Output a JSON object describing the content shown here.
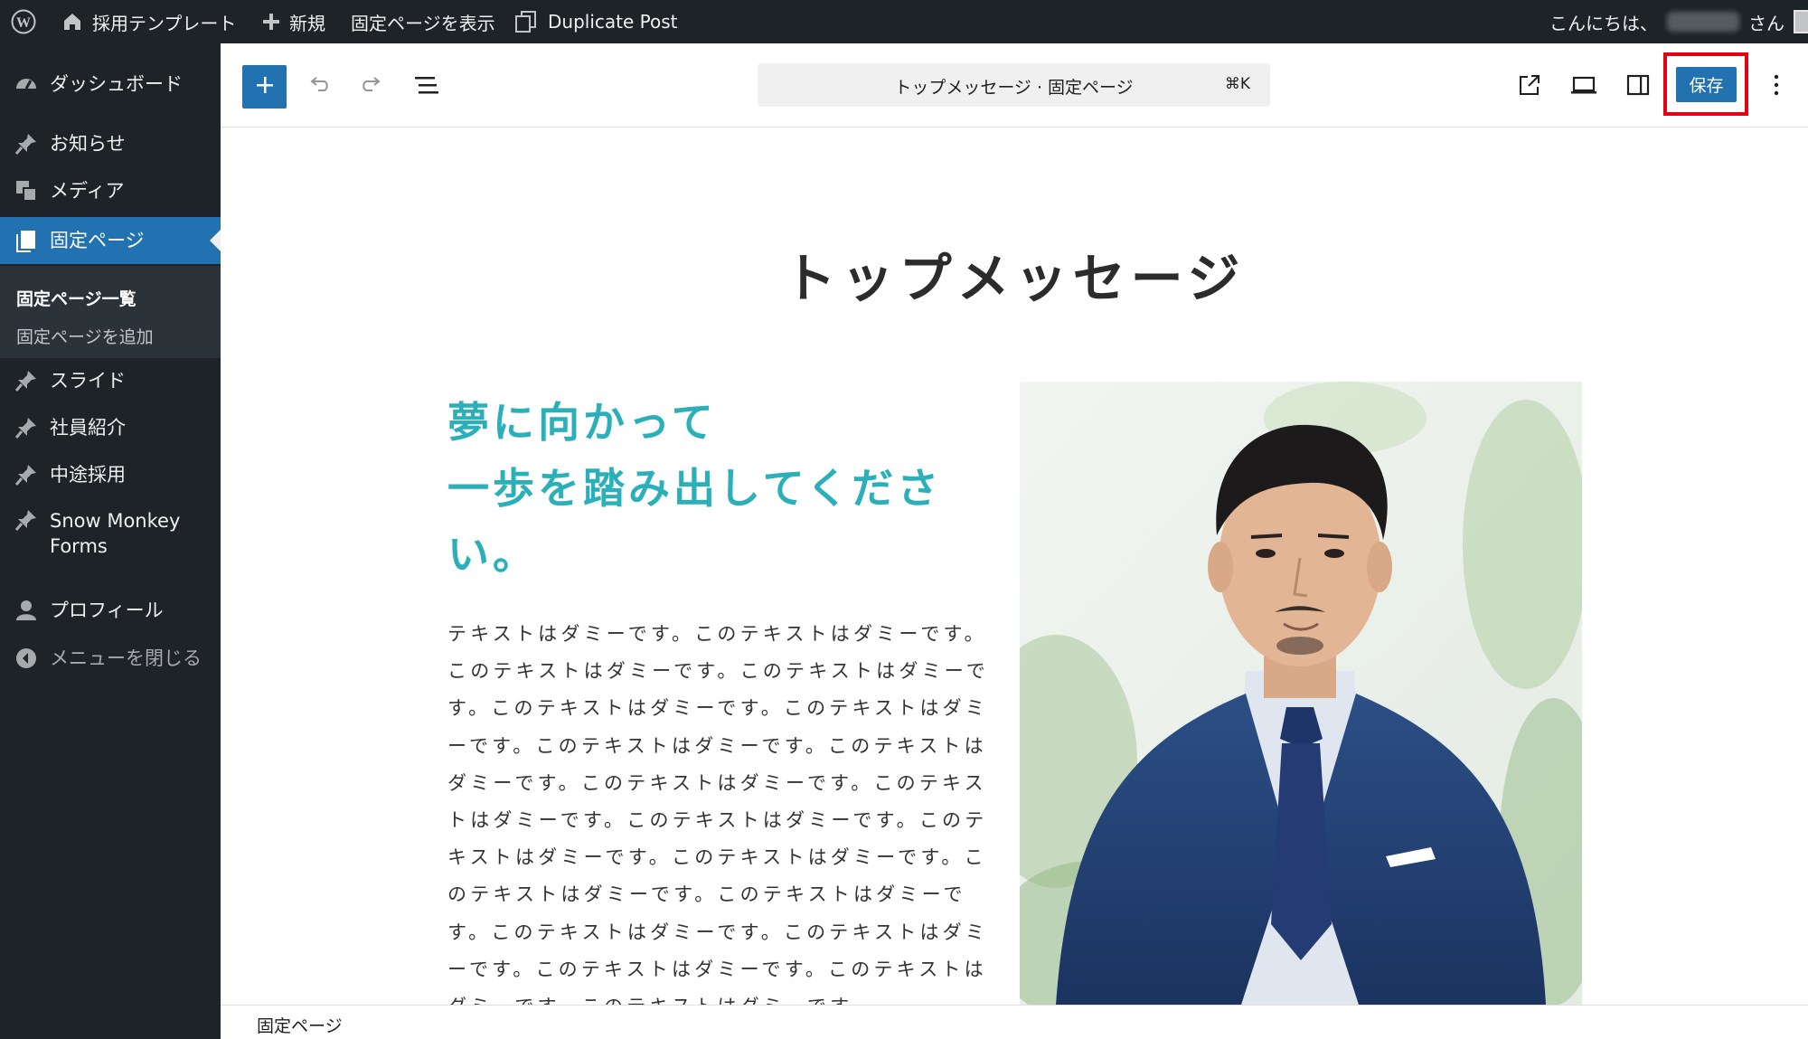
{
  "admin_bar": {
    "site_name": "採用テンプレート",
    "new_label": "新規",
    "view_page_label": "固定ページを表示",
    "duplicate_label": "Duplicate Post",
    "greeting_prefix": "こんにちは、",
    "greeting_suffix": "さん",
    "icons": [
      "wordpress-logo-icon",
      "home-icon",
      "plus-icon",
      "duplicate-icon",
      "avatar-icon"
    ]
  },
  "sidebar": {
    "items": [
      {
        "label": "ダッシュボード",
        "icon": "dashboard-icon"
      },
      {
        "label": "お知らせ",
        "icon": "pin-icon"
      },
      {
        "label": "メディア",
        "icon": "media-icon"
      },
      {
        "label": "固定ページ",
        "icon": "page-icon",
        "current": true
      },
      {
        "label": "スライド",
        "icon": "pin-icon"
      },
      {
        "label": "社員紹介",
        "icon": "pin-icon"
      },
      {
        "label": "中途採用",
        "icon": "pin-icon"
      },
      {
        "label": "Snow Monkey Forms",
        "icon": "pin-icon"
      },
      {
        "label": "プロフィール",
        "icon": "user-icon"
      },
      {
        "label": "メニューを閉じる",
        "icon": "collapse-icon"
      }
    ],
    "submenu": [
      {
        "label": "固定ページ一覧",
        "current": true
      },
      {
        "label": "固定ページを追加"
      }
    ]
  },
  "toolbar": {
    "document_title": "トップメッセージ · 固定ページ",
    "shortcut": "⌘K",
    "save_label": "保存",
    "icons": [
      "plus-icon",
      "undo-icon",
      "redo-icon",
      "list-view-icon",
      "external-link-icon",
      "device-preview-icon",
      "sidebar-toggle-icon",
      "more-options-icon"
    ]
  },
  "content": {
    "heading": "トップメッセージ",
    "lead_line1": "夢に向かって",
    "lead_line2": "一歩を踏み出してくださ",
    "lead_line3": "い。",
    "body_lines": [
      "テキストはダミーです。このテキストはダミーです。",
      "このテキストはダミーです。このテキストはダミーで",
      "す。このテキストはダミーです。このテキストはダミ",
      "ーです。このテキストはダミーです。このテキストは",
      "ダミーです。このテキストはダミーです。このテキス",
      "トはダミーです。このテキストはダミーです。このテ",
      "キストはダミーです。このテキストはダミーです。こ",
      "のテキストはダミーです。このテキストはダミーで",
      "す。このテキストはダミーです。このテキストはダミ",
      "ーです。このテキストはダミーです。このテキストは",
      "ダミーです。このテキストはダミーです。"
    ]
  },
  "status_bar": {
    "breadcrumb": "固定ページ"
  },
  "colors": {
    "admin_dark": "#1d2327",
    "accent_blue": "#2271b1",
    "lead_teal": "#2bb0b9",
    "highlight_red": "#e60012"
  }
}
